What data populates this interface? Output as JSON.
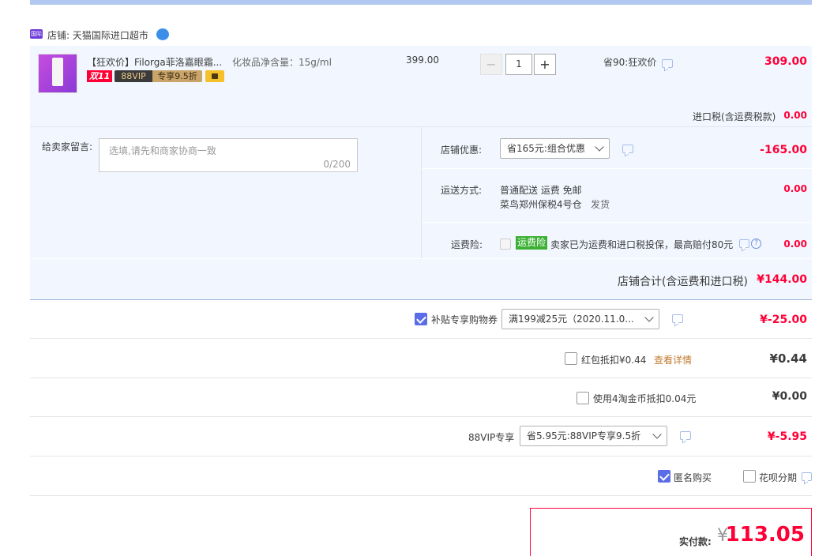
{
  "shop": {
    "badge": "国际",
    "label": "店铺: 天猫国际进口超市"
  },
  "item": {
    "title": "【狂欢价】Filorga菲洛嘉眼霜...",
    "spec": "化妆品净含量：15g/ml",
    "tag_double11": "双11",
    "tag_vip": "88VIP",
    "tag_vip_discount": "专享9.5折",
    "unit_price": "399.00",
    "quantity": "1",
    "minus": "−",
    "plus": "+",
    "promo": "省90:狂欢价",
    "subtotal": "309.00"
  },
  "import_tax": {
    "label": "进口税(含运费税款)",
    "value": "0.00"
  },
  "message": {
    "label": "给卖家留言:",
    "placeholder": "选填,请先和商家协商一致",
    "counter": "0/200"
  },
  "store_discount": {
    "label": "店铺优惠:",
    "selected": "省165元:组合优惠",
    "value": "-165.00"
  },
  "shipping": {
    "label": "运送方式:",
    "line1": "普通配送 运费 免邮",
    "warehouse": "菜鸟郑州保税4号仓",
    "ship_text": "发货",
    "value": "0.00"
  },
  "insurance": {
    "label": "运费险:",
    "badge": "运费险",
    "text": "卖家已为运费和进口税投保，最高赔付80元",
    "help": "?",
    "value": "0.00"
  },
  "store_total": {
    "label": "店铺合计(含运费和进口税)",
    "value": "¥144.00"
  },
  "coupon": {
    "label": "补贴专享购物券",
    "selected": "满199减25元（2020.11.0...",
    "value": "¥-25.00"
  },
  "red_packet": {
    "label": "红包抵扣¥0.44",
    "link": "查看详情",
    "value": "¥0.44"
  },
  "tao_coin": {
    "label": "使用4淘金币抵扣0.04元",
    "value": "¥0.00"
  },
  "vip88": {
    "label": "88VIP专享",
    "selected": "省5.95元:88VIP专享9.5折",
    "value": "¥-5.95"
  },
  "options": {
    "anonymous": "匿名购买",
    "installment": "花呗分期"
  },
  "payment": {
    "label": "实付款:",
    "currency": "¥",
    "amount": "113.05"
  },
  "colors": {
    "accent": "#ff0036",
    "checkbox": "#5b6de6",
    "panel": "#f2f7ff",
    "insurance_green": "#3cb034"
  }
}
